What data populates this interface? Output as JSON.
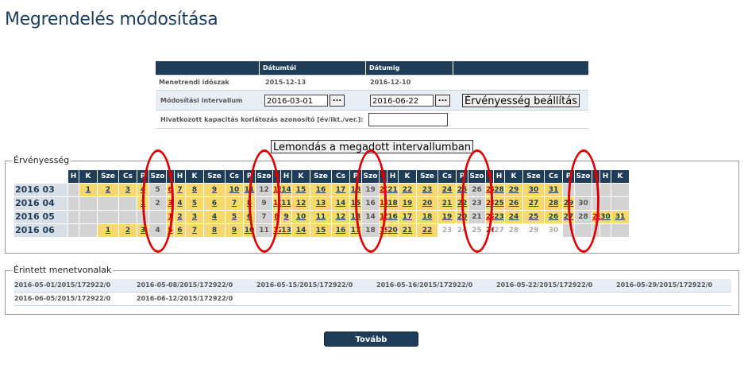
{
  "page": {
    "title": "Megrendelés módosítása"
  },
  "form": {
    "col_from": "Dátumtól",
    "col_to": "Dátumig",
    "row1_label": "Menetrendi időszak",
    "row1_from": "2015-12-13",
    "row1_to": "2016-12-10",
    "row2_label": "Módosítási intervallum",
    "row2_from": "2016-03-01",
    "row2_to": "2016-06-22",
    "picker_label": "...",
    "set_validity": "Érvényesség beállítás",
    "row3_label": "Hivatkozott kapacitás korlátozás azonosító [év/ikt./ver.]:",
    "row3_value": ""
  },
  "cancel_button": "Lemondás a megadott intervallumban",
  "validity": {
    "legend": "Érvényesség",
    "day_headers": [
      "H",
      "K",
      "Sze",
      "Cs",
      "P",
      "Szo",
      "V"
    ],
    "months": [
      {
        "label": "2016 03",
        "offset": 1,
        "days": 31,
        "avail_from": 1,
        "avail_to": 31
      },
      {
        "label": "2016 04",
        "offset": 4,
        "days": 30,
        "avail_from": 1,
        "avail_to": 30
      },
      {
        "label": "2016 05",
        "offset": 6,
        "days": 31,
        "avail_from": 1,
        "avail_to": 31
      },
      {
        "label": "2016 06",
        "offset": 2,
        "days": 30,
        "avail_from": 1,
        "avail_to": 22
      }
    ]
  },
  "routes": {
    "legend": "Érintett menetvonalak",
    "rows": [
      [
        "2016-05-01/2015/172922/0",
        "2016-05-08/2015/172922/0",
        "2016-05-15/2015/172922/0",
        "2016-05-16/2015/172922/0",
        "2016-05-22/2015/172922/0",
        "2016-05-29/2015/172922/0"
      ],
      [
        "2016-06-05/2015/172922/0",
        "2016-06-12/2015/172922/0"
      ]
    ]
  },
  "next_button": "Tovább",
  "colors": {
    "header": "#1f3d59",
    "available": "#f6d96a",
    "highlight_ring": "#e00000"
  }
}
